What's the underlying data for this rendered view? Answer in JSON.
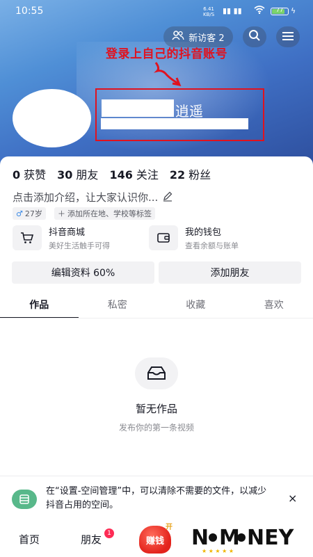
{
  "status_bar": {
    "time": "10:55",
    "speed": "6.41",
    "speed_unit": "KB/S",
    "battery": "77"
  },
  "header": {
    "visitors_label": "新访客 2"
  },
  "annotation": {
    "text": "登录上自己的抖音账号"
  },
  "profile": {
    "name_visible": "逍遥",
    "intro": "点击添加介绍，让大家认识你...",
    "age_tag": "27岁",
    "add_tag": "添加所在地、学校等标签"
  },
  "stats": [
    {
      "num": "0",
      "label": "获赞"
    },
    {
      "num": "30",
      "label": "朋友"
    },
    {
      "num": "146",
      "label": "关注"
    },
    {
      "num": "22",
      "label": "粉丝"
    }
  ],
  "services": [
    {
      "title": "抖音商城",
      "subtitle": "美好生活触手可得"
    },
    {
      "title": "我的钱包",
      "subtitle": "查看余额与账单"
    }
  ],
  "actions": {
    "edit": "编辑资料 60%",
    "add_friend": "添加朋友"
  },
  "tabs": [
    "作品",
    "私密",
    "收藏",
    "喜欢"
  ],
  "empty": {
    "title": "暂无作品",
    "subtitle": "发布你的第一条视频"
  },
  "notice": {
    "text": "在“设置-空间管理”中，可以清除不需要的文件，以减少抖音占用的空间。",
    "close": "×"
  },
  "bottom_nav": {
    "home": "首页",
    "friends": "朋友",
    "friends_badge": "1",
    "earn": "赚钱",
    "earn_top": "开"
  },
  "logo": {
    "text": "NOMONEY"
  }
}
